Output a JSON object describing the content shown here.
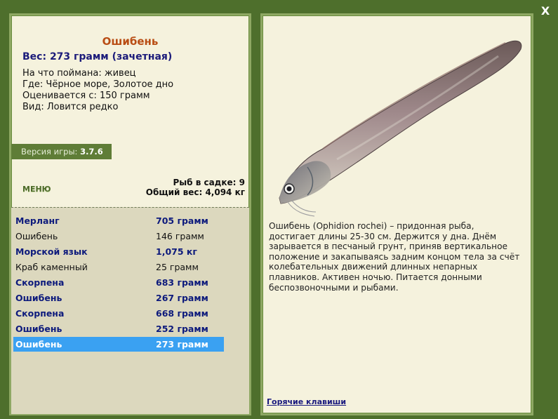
{
  "close": {
    "label": "X"
  },
  "fish": {
    "title": "Ошибень",
    "weight_line": "Вес: 273 грамм (зачетная)",
    "caught_with": "На что поймана: живец",
    "where": "Где: Чёрное море, Золотое дно",
    "valued_from": "Оценивается с: 150 грамм",
    "kind": "Вид: Ловится редко"
  },
  "version": {
    "label": "Версия игры:",
    "value": "3.7.6"
  },
  "menu": {
    "label": "МЕНЮ"
  },
  "stats": {
    "fish_in_net": "Рыб в садке: 9",
    "total_weight": "Общий вес: 4,094 кг"
  },
  "catch_list": [
    {
      "name": "Мерланг",
      "weight": "705 грамм",
      "style": "bold"
    },
    {
      "name": "Ошибень",
      "weight": "146 грамм",
      "style": "plain"
    },
    {
      "name": "Морской язык",
      "weight": "1,075 кг",
      "style": "bold"
    },
    {
      "name": "Краб каменный",
      "weight": "25 грамм",
      "style": "plain"
    },
    {
      "name": "Скорпена",
      "weight": "683 грамм",
      "style": "bold"
    },
    {
      "name": "Ошибень",
      "weight": "267 грамм",
      "style": "bold"
    },
    {
      "name": "Скорпена",
      "weight": "668 грамм",
      "style": "bold"
    },
    {
      "name": "Ошибень",
      "weight": "252 грамм",
      "style": "bold"
    },
    {
      "name": "Ошибень",
      "weight": "273 грамм",
      "style": "selected"
    }
  ],
  "description": "Ошибень (Ophidion rochei) – придонная рыба, достигает длины 25-30 см. Держится у дна. Днём зарывается в песчаный грунт, приняв вертикальное положение и закапываясь задним концом тела за счёт колебательных движений длинных непарных плавников. Активен ночью. Питается донными беспозвоночными и рыбами.",
  "hotkeys": {
    "label": "Горячие клавиши"
  }
}
